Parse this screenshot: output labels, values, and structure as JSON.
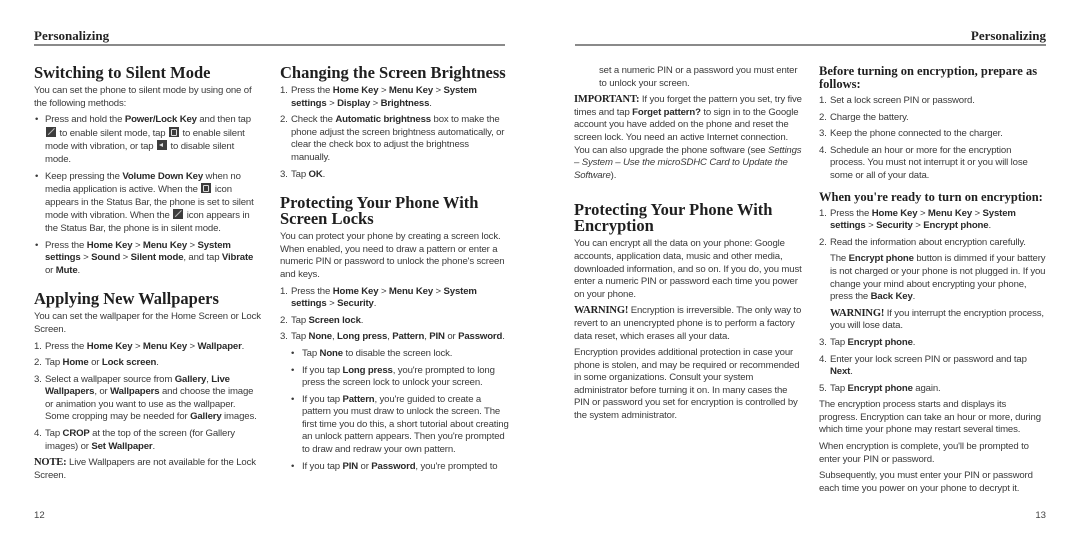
{
  "header": {
    "left": "Personalizing",
    "right": "Personalizing"
  },
  "page_numbers": {
    "left": "12",
    "right": "13"
  },
  "silent_mode": {
    "title": "Switching to Silent Mode",
    "intro": "You can set the phone to silent mode by using one of the following methods:",
    "b1": {
      "t1": "Press and hold the ",
      "k1": "Power/Lock Key",
      "t2": " and then tap ",
      "t3": " to enable silent mode, tap ",
      "t4": " to enable silent mode with vibration, or tap ",
      "t5": " to disable silent mode.",
      "icons": [
        "silent-mode-icon",
        "vibrate-mode-icon",
        "sound-on-icon"
      ]
    },
    "b2": {
      "t1": "Keep pressing the ",
      "k1": "Volume Down Key",
      "t2": " when no media application is active. When the ",
      "t3": " icon appears in the Status Bar, the phone is set to silent mode with vibration. When the ",
      "t4": " icon appears in the Status Bar, the phone is in silent mode."
    },
    "b3": {
      "t1": "Press the ",
      "k1": "Home Key",
      "s1": " > ",
      "k2": "Menu Key",
      "s2": " > ",
      "k3": "System settings",
      "s3": " > ",
      "k4": "Sound",
      "s4": " > ",
      "k5": "Silent mode",
      "t2": ", and tap ",
      "k6": "Vibrate",
      "t3": " or ",
      "k7": "Mute",
      "t4": "."
    }
  },
  "wallpapers": {
    "title": "Applying New Wallpapers",
    "intro": "You can set the wallpaper for the Home Screen or Lock Screen.",
    "s1": {
      "n": "1.",
      "t1": "Press the ",
      "k1": "Home Key",
      "s1": " > ",
      "k2": "Menu Key",
      "s2": " > ",
      "k3": "Wallpaper",
      "t2": "."
    },
    "s2": {
      "n": "2.",
      "t1": "Tap ",
      "k1": "Home",
      "t2": " or ",
      "k2": "Lock screen",
      "t3": "."
    },
    "s3": {
      "n": "3.",
      "t1": "Select a wallpaper source from ",
      "k1": "Gallery",
      "t2": ", ",
      "k2": "Live Wallpapers",
      "t3": ", or ",
      "k3": "Wallpapers",
      "t4": " and choose the image or animation you want to use as the wallpaper. Some cropping may be needed for ",
      "k4": "Gallery",
      "t5": " images."
    },
    "s4": {
      "n": "4.",
      "t1": "Tap ",
      "k1": "CROP",
      "t2": " at the top of the screen (for Gallery images) or ",
      "k2": "Set Wallpaper",
      "t3": "."
    },
    "note_label": "NOTE:",
    "note": " Live Wallpapers are not available for the Lock Screen."
  },
  "brightness": {
    "title": "Changing the Screen Brightness",
    "s1": {
      "n": "1.",
      "t1": "Press the ",
      "k1": "Home Key",
      "s1": " > ",
      "k2": "Menu Key",
      "s2": " > ",
      "k3": "System settings",
      "s3": " > ",
      "k4": "Display",
      "s4": " > ",
      "k5": "Brightness",
      "t2": "."
    },
    "s2": {
      "n": "2.",
      "t1": "Check the ",
      "k1": "Automatic brightness",
      "t2": " box to make the phone adjust the screen brightness automatically, or clear the check box to adjust the brightness manually."
    },
    "s3": {
      "n": "3.",
      "t1": "Tap ",
      "k1": "OK",
      "t2": "."
    }
  },
  "screen_locks": {
    "title": "Protecting Your Phone With Screen Locks",
    "intro": "You can protect your phone by creating a screen lock. When enabled, you need to draw a pattern or enter a numeric PIN or password to unlock the phone's screen and keys.",
    "s1": {
      "n": "1.",
      "t1": "Press the ",
      "k1": "Home Key",
      "s1": " > ",
      "k2": "Menu Key",
      "s2": " > ",
      "k3": "System settings",
      "s3": " > ",
      "k4": "Security",
      "t2": "."
    },
    "s2": {
      "n": "2.",
      "t1": "Tap ",
      "k1": "Screen lock",
      "t2": "."
    },
    "s3": {
      "n": "3.",
      "t1": "Tap ",
      "k1": "None",
      "c1": ", ",
      "k2": "Long press",
      "c2": ", ",
      "k3": "Pattern",
      "c3": ", ",
      "k4": "PIN",
      "t2": " or ",
      "k5": "Password",
      "t3": "."
    },
    "sub1": {
      "t1": "Tap ",
      "k1": "None",
      "t2": " to disable the screen lock."
    },
    "sub2": {
      "t1": "If you tap ",
      "k1": "Long press",
      "t2": ", you're prompted to long press the screen lock to unlock your screen."
    },
    "sub3": {
      "t1": "If you tap ",
      "k1": "Pattern",
      "t2": ", you're guided to create a pattern you must draw to unlock the screen. The first time you do this, a short tutorial about creating an unlock pattern appears. Then you're prompted to draw and redraw your own pattern."
    },
    "sub4": {
      "t1": "If you tap ",
      "k1": "PIN",
      "t2": " or ",
      "k2": "Password",
      "t3": ", you're prompted to"
    },
    "sub4_cont": "set a numeric PIN or a password you must enter to unlock your screen.",
    "important_label": "IMPORTANT:",
    "important": {
      "t1": " If you forget the pattern you set, try five times and tap ",
      "k1": "Forget pattern?",
      "t2": " to sign in to the Google account you have added on the phone and reset the screen lock. You need an active Internet connection. You can also upgrade the phone software (see ",
      "i1": "Settings – System – Use the microSDHC Card to Update the Software",
      "t3": ")."
    }
  },
  "encryption": {
    "title": "Protecting Your Phone With Encryption",
    "intro": "You can encrypt all the data on your phone: Google accounts, application data, music and other media, downloaded information, and so on. If you do, you must enter a numeric PIN or password each time you power on your phone.",
    "warning_label": "WARNING!",
    "warning": " Encryption is irreversible. The only way to revert to an unencrypted phone is to perform a factory data reset, which erases all your data.",
    "para": "Encryption provides additional protection in case your phone is stolen, and may be required or recommended in some organizations. Consult your system administrator before turning it on. In many cases the PIN or password you set for encryption is controlled by the system administrator."
  },
  "before_encryption": {
    "title": "Before turning on encryption, prepare as follows:",
    "steps": [
      {
        "n": "1.",
        "text": "Set a lock screen PIN or password."
      },
      {
        "n": "2.",
        "text": "Charge the battery."
      },
      {
        "n": "3.",
        "text": "Keep the phone connected to the charger."
      },
      {
        "n": "4.",
        "text": "Schedule an hour or more for the encryption process. You must not interrupt it or you will lose some or all of your data."
      }
    ]
  },
  "ready_encryption": {
    "title": "When you're ready to turn on encryption:",
    "s1": {
      "n": "1.",
      "t1": "Press the ",
      "k1": "Home Key",
      "s1": " > ",
      "k2": "Menu Key",
      "s2": " > ",
      "k3": "System settings",
      "s3": " > ",
      "k4": "Security",
      "s4": " > ",
      "k5": "Encrypt phone",
      "t2": "."
    },
    "s2": {
      "n": "2.",
      "text": "Read the information about encryption carefully."
    },
    "s2_note": {
      "t1": "The ",
      "k1": "Encrypt phone",
      "t2": " button is dimmed if your battery is not charged or your phone is not plugged in. If you change your mind about encrypting your phone, press the ",
      "k2": "Back Key",
      "t3": "."
    },
    "s2_warning_label": "WARNING!",
    "s2_warning": " If you interrupt the encryption process, you will lose data.",
    "s3": {
      "n": "3.",
      "t1": "Tap ",
      "k1": "Encrypt phone",
      "t2": "."
    },
    "s4": {
      "n": "4.",
      "t1": "Enter your lock screen PIN or password and tap ",
      "k1": "Next",
      "t2": "."
    },
    "s5": {
      "n": "5.",
      "t1": "Tap ",
      "k1": "Encrypt phone",
      "t2": " again."
    },
    "p1": "The encryption process starts and displays its progress. Encryption can take an hour or more, during which time your phone may restart several times.",
    "p2": "When encryption is complete, you'll be prompted to enter your PIN or password.",
    "p3": "Subsequently, you must enter your PIN or password each time you power on your phone to decrypt it."
  }
}
